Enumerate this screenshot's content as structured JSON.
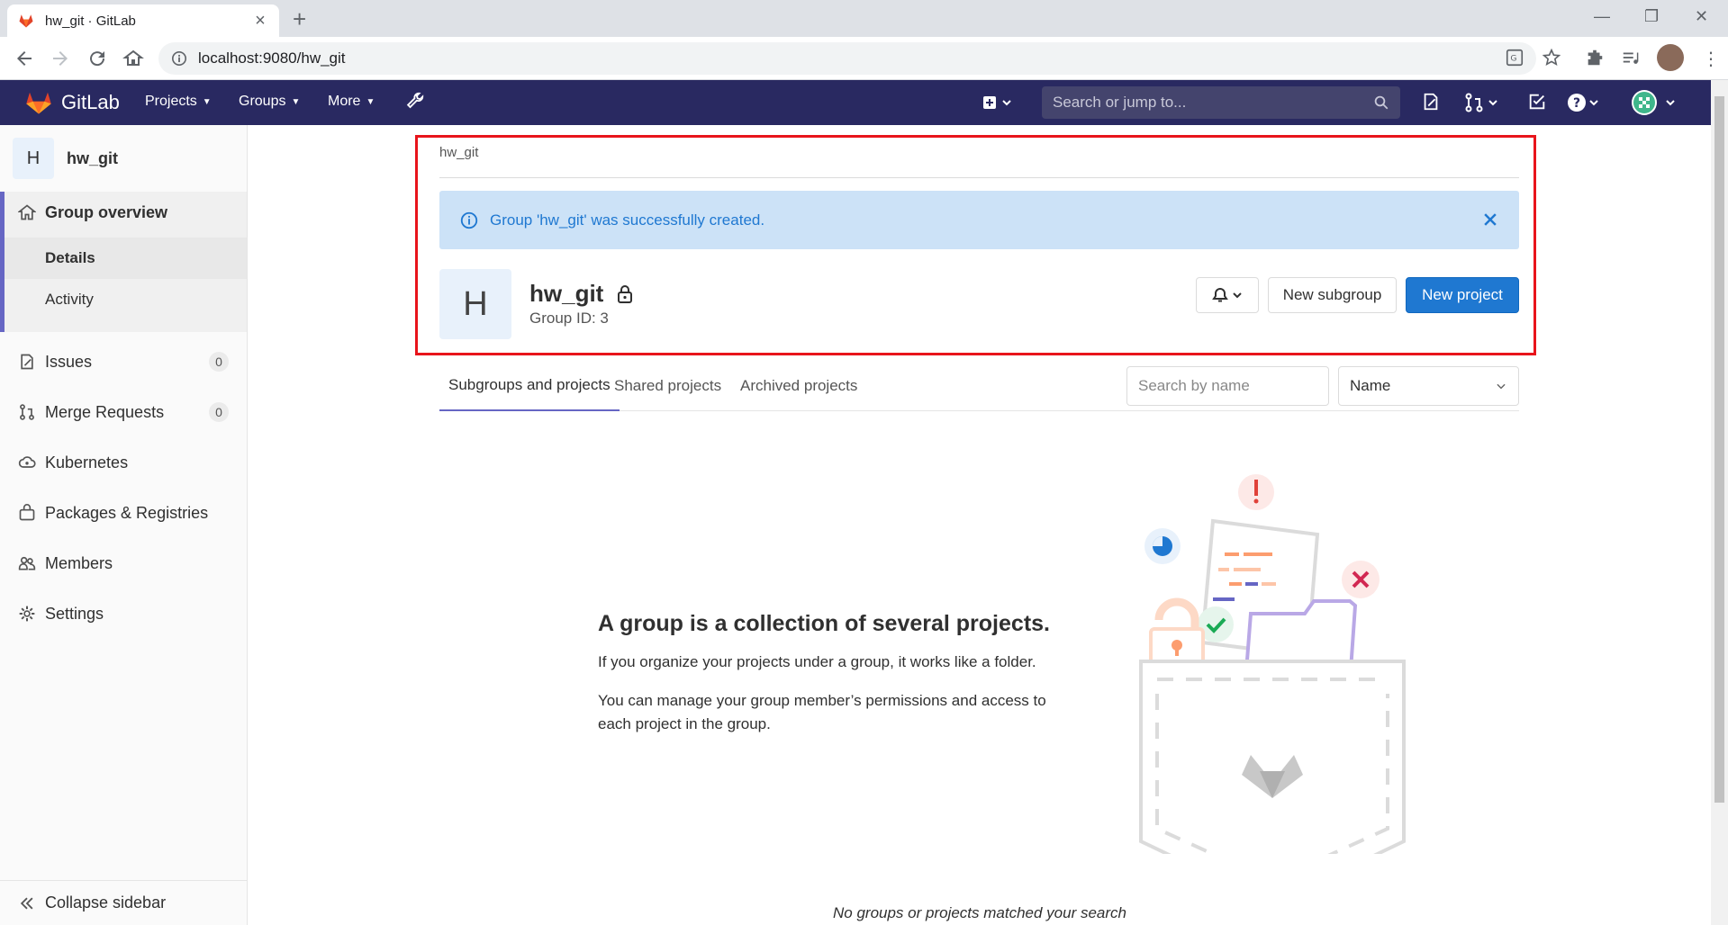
{
  "browser": {
    "tab_title": "hw_git · GitLab",
    "url": "localhost:9080/hw_git"
  },
  "topnav": {
    "brand": "GitLab",
    "menu": [
      "Projects",
      "Groups",
      "More"
    ],
    "search_placeholder": "Search or jump to..."
  },
  "sidebar": {
    "group_avatar_letter": "H",
    "group_name": "hw_git",
    "overview_label": "Group overview",
    "details_label": "Details",
    "activity_label": "Activity",
    "issues": {
      "label": "Issues",
      "count": "0"
    },
    "merge_requests": {
      "label": "Merge Requests",
      "count": "0"
    },
    "kubernetes_label": "Kubernetes",
    "packages_label": "Packages & Registries",
    "members_label": "Members",
    "settings_label": "Settings",
    "collapse_label": "Collapse sidebar"
  },
  "content": {
    "breadcrumb": "hw_git",
    "alert": "Group 'hw_git' was successfully created.",
    "group_avatar_letter": "H",
    "group_name": "hw_git",
    "group_id": "Group ID: 3",
    "new_subgroup": "New subgroup",
    "new_project": "New project",
    "tabs": [
      "Subgroups and projects",
      "Shared projects",
      "Archived projects"
    ],
    "search_placeholder": "Search by name",
    "sort_value": "Name",
    "empty_title": "A group is a collection of several projects.",
    "empty_p1": "If you organize your projects under a group, it works like a folder.",
    "empty_p2": "You can manage your group member’s permissions and access to each project in the group.",
    "no_match": "No groups or projects matched your search"
  },
  "colors": {
    "nav_bg": "#292961",
    "primary": "#1f78d1",
    "alert_bg": "#cce2f7",
    "highlight": "#e8141b",
    "active_accent": "#6666c4"
  }
}
